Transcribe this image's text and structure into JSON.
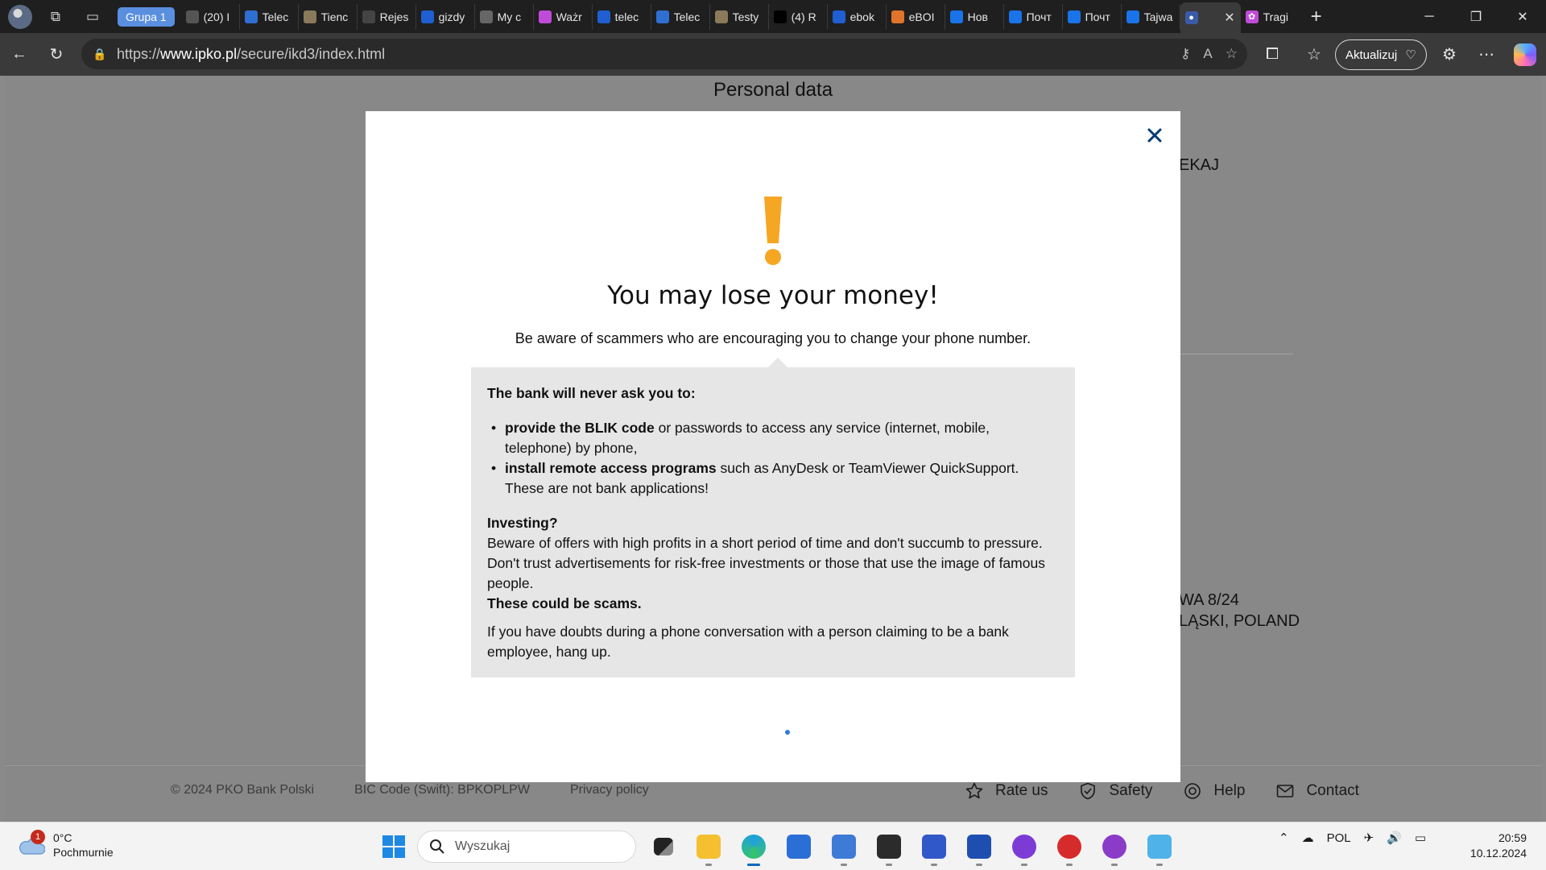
{
  "browser": {
    "group_label": "Grupa 1",
    "tabs": [
      {
        "label": "(20) I",
        "color": "#555555"
      },
      {
        "label": "Telec",
        "color": "#2f6fd1"
      },
      {
        "label": "Tienc",
        "color": "#8a7a5a"
      },
      {
        "label": "Rejes",
        "color": "#444444"
      },
      {
        "label": "gizdy",
        "color": "#1f5fd1"
      },
      {
        "label": "My c",
        "color": "#666666"
      },
      {
        "label": "Ważr",
        "color": "#c04bd8"
      },
      {
        "label": "telec",
        "color": "#1f5fd1"
      },
      {
        "label": "Telec",
        "color": "#2f6fd1"
      },
      {
        "label": "Testy",
        "color": "#8a7a5a"
      },
      {
        "label": "(4) R",
        "color": "#000000"
      },
      {
        "label": "ebok",
        "color": "#1f5fd1"
      },
      {
        "label": "eBOI",
        "color": "#e0742b"
      },
      {
        "label": "Нов",
        "color": "#1a73e8"
      },
      {
        "label": "Почт",
        "color": "#1a73e8"
      },
      {
        "label": "Почт",
        "color": "#1a73e8"
      },
      {
        "label": "Tajwa",
        "color": "#1a73e8"
      }
    ],
    "active_tab_label": "",
    "last_tab_label": "Tragi",
    "url_prefix": "https://",
    "url_host": "www.ipko.pl",
    "url_path": "/secure/ikd3/index.html",
    "update_button": "Aktualizuj"
  },
  "page": {
    "title": "Personal data",
    "bg_fragment_1": "EKAJ",
    "bg_fragment_2": "WA 8/24",
    "bg_fragment_3": "LĄSKI, POLAND",
    "footer": {
      "copyright": "© 2024 PKO Bank Polski",
      "bic": "BIC Code (Swift): BPKOPLPW",
      "privacy": "Privacy policy",
      "rate": "Rate us",
      "safety": "Safety",
      "help": "Help",
      "contact": "Contact"
    }
  },
  "modal": {
    "heading": "You may lose your money!",
    "subheading": "Be aware of scammers who are encouraging you to change your phone number.",
    "never_ask": "The bank will never ask you to:",
    "bullet1_bold": "provide the BLIK code",
    "bullet1_rest": " or passwords to access any service (internet, mobile, telephone) by phone,",
    "bullet2_bold": "install remote access programs",
    "bullet2_rest": " such as AnyDesk or TeamViewer QuickSupport. These are not bank applications!",
    "investing_title": "Investing?",
    "investing_text": "Beware of offers with high profits in a short period of time and don't succumb to pressure. Don't trust advertisements for risk-free investments or those that use the image of famous people.",
    "scams": "These could be scams.",
    "doubts": "If you have doubts during a phone conversation with a person claiming to be a bank employee, hang up.",
    "accent_color": "#f5a623",
    "close_color": "#003a70"
  },
  "taskbar": {
    "weather_temp": "0°C",
    "weather_desc": "Pochmurnie",
    "weather_badge": "1",
    "search_placeholder": "Wyszukaj",
    "lang": "POL",
    "time": "20:59",
    "date": "10.12.2024"
  }
}
